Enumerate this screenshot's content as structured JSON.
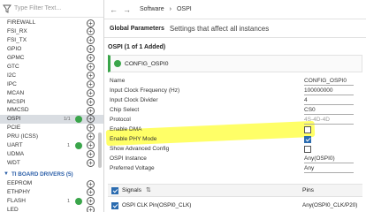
{
  "left_panel": {
    "filter_placeholder": "Type Filter Text...",
    "items": [
      {
        "label": "FIREWALL"
      },
      {
        "label": "FSI_RX"
      },
      {
        "label": "FSI_TX"
      },
      {
        "label": "GPIO"
      },
      {
        "label": "GPMC"
      },
      {
        "label": "GTC"
      },
      {
        "label": "I2C"
      },
      {
        "label": "IPC"
      },
      {
        "label": "MCAN"
      },
      {
        "label": "MCSPI"
      },
      {
        "label": "MMCSD"
      },
      {
        "label": "OSPI",
        "count": "1/1",
        "selected": true
      },
      {
        "label": "PCIE"
      },
      {
        "label": "PRU (ICSS)"
      },
      {
        "label": "UART",
        "count": "1"
      },
      {
        "label": "UDMA"
      },
      {
        "label": "WDT"
      }
    ],
    "group_label": "TI BOARD DRIVERS (5)",
    "board_items": [
      {
        "label": "EEPROM"
      },
      {
        "label": "ETHPHY"
      },
      {
        "label": "FLASH",
        "count": "1"
      },
      {
        "label": "LED"
      }
    ]
  },
  "breadcrumb": {
    "back": "←",
    "forward": "→",
    "item1": "Software",
    "sep": "›",
    "item2": "OSPI"
  },
  "global_params": {
    "title": "Global Parameters",
    "desc": "Settings that affect all instances"
  },
  "module_header": "OSPI (1 of 1 Added)",
  "instance": {
    "name": "CONFIG_OSPI0"
  },
  "params": [
    {
      "key": "Name",
      "value": "CONFIG_OSPI0",
      "type": "text"
    },
    {
      "key": "Input Clock Frequency (Hz)",
      "value": "100000000",
      "type": "text"
    },
    {
      "key": "Input Clock Divider",
      "value": "4",
      "type": "text"
    },
    {
      "key": "Chip Select",
      "value": "CS0",
      "type": "text"
    },
    {
      "key": "Protocol",
      "value": "4S-4D-4D",
      "type": "placeholder"
    },
    {
      "key": "Enable DMA",
      "checked": false,
      "type": "check"
    },
    {
      "key": "Enable PHY Mode",
      "checked": true,
      "type": "check"
    },
    {
      "key": "Show Advanced Config",
      "checked": false,
      "type": "check"
    },
    {
      "key": "OSPI Instance",
      "value": "Any(OSPI0)",
      "type": "text"
    },
    {
      "key": "Preferred Voltage",
      "value": "Any",
      "type": "text"
    }
  ],
  "signals": {
    "label": "Signals",
    "sort_icon": "⇅",
    "pins_label": "Pins",
    "row_label": "OSPI CLK Pin(OSPI0_CLK)",
    "row_value": "Any(OSPI0_CLK/P20)"
  },
  "colors": {
    "accent": "#2a5ea8",
    "ok": "#3aa54a",
    "highlight": "#ffff3c"
  }
}
